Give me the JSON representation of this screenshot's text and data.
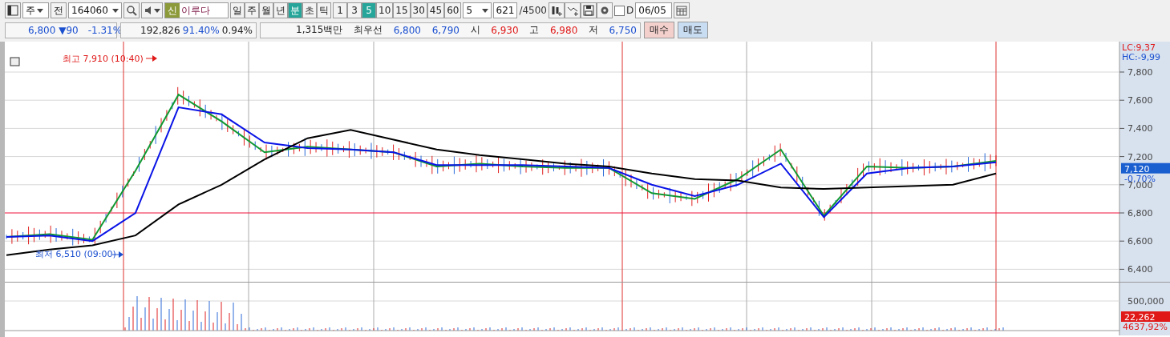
{
  "toolbar": {
    "market": "주",
    "all_button": "전",
    "code": "164060",
    "badge": "신",
    "name": "이루다",
    "periods": [
      {
        "label": "일",
        "selected": false
      },
      {
        "label": "주",
        "selected": false
      },
      {
        "label": "월",
        "selected": false
      },
      {
        "label": "년",
        "selected": false
      },
      {
        "label": "분",
        "selected": true
      },
      {
        "label": "초",
        "selected": false
      },
      {
        "label": "틱",
        "selected": false
      }
    ],
    "intervals": [
      {
        "label": "1",
        "selected": false
      },
      {
        "label": "3",
        "selected": false
      },
      {
        "label": "5",
        "selected": true
      },
      {
        "label": "10",
        "selected": false
      },
      {
        "label": "15",
        "selected": false
      },
      {
        "label": "30",
        "selected": false
      },
      {
        "label": "45",
        "selected": false
      },
      {
        "label": "60",
        "selected": false
      }
    ],
    "count_combo": "5",
    "count": "621",
    "total": "/4500",
    "d_checkbox": {
      "label": "D",
      "checked": false
    },
    "date": "06/05"
  },
  "quote_bar": {
    "price": "6,800",
    "arrow": "▼",
    "change": "90",
    "change_rate": "-1.31%",
    "volume": "192,826",
    "volume_rate": "91.40%",
    "turnover": "0.94%",
    "amount": "1,315백만",
    "best_label": "최우선",
    "ask": "6,800",
    "bid": "6,790",
    "open_label": "시",
    "open": "6,930",
    "high_label": "고",
    "high": "6,980",
    "low_label": "저",
    "low": "6,750",
    "buy_button": "매수",
    "sell_button": "매도"
  },
  "price_chart": {
    "high_marker": "최고 7,910 (10:40)",
    "low_marker": "최저 6,510 (09:00)",
    "lc": "LC:9,37",
    "hc": "HC:-9,99",
    "price_tag": "7,120",
    "change_tag": "-0,70%",
    "axis_labels": [
      "7,800",
      "7,600",
      "7,400",
      "7,200",
      "7,000",
      "6,800",
      "6,600",
      "6,400"
    ]
  },
  "volume_chart": {
    "axis_label": "500,000",
    "volume_tag": "22,262",
    "ratio_tag": "4637,92%"
  }
}
